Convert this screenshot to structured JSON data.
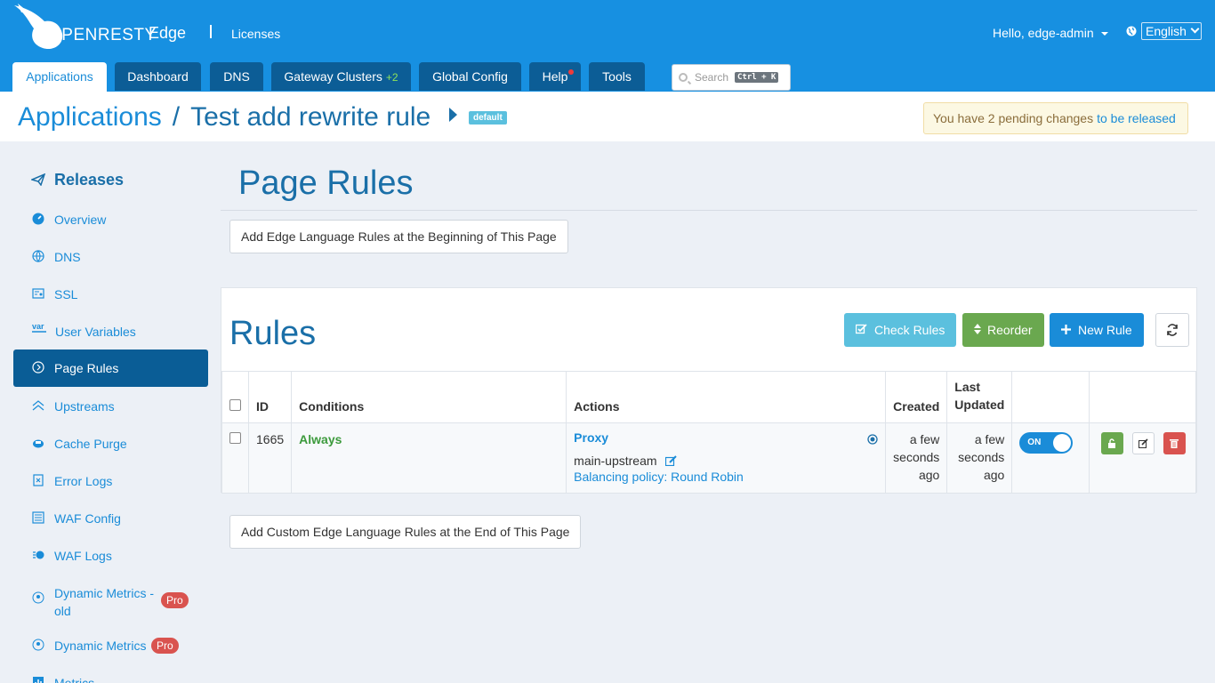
{
  "header": {
    "logo_text": "OPENRESTY",
    "product": "Edge",
    "licenses": "Licenses",
    "user": "Hello, edge-admin",
    "language": "English",
    "nav_tabs": [
      {
        "label": "Applications",
        "active": true
      },
      {
        "label": "Dashboard"
      },
      {
        "label": "DNS"
      },
      {
        "label": "Gateway Clusters",
        "extra": "+2"
      },
      {
        "label": "Global Config"
      },
      {
        "label": "Help",
        "notification_dot": true
      },
      {
        "label": "Tools"
      }
    ],
    "search": {
      "placeholder": "Search",
      "shortcut": "Ctrl + K"
    }
  },
  "breadcrumb": {
    "root": "Applications",
    "separator": "/",
    "current": "Test add rewrite rule",
    "badge": "default"
  },
  "pending": {
    "text": "You have 2 pending changes",
    "link": "to be released"
  },
  "sidebar": {
    "heading": "Releases",
    "items": [
      {
        "label": "Overview",
        "icon": "dashboard-icon"
      },
      {
        "label": "DNS",
        "icon": "globe-icon"
      },
      {
        "label": "SSL",
        "icon": "certificate-icon"
      },
      {
        "label": "User Variables",
        "icon": "var-icon"
      },
      {
        "label": "Page Rules",
        "icon": "rules-icon",
        "active": true
      },
      {
        "label": "Upstreams",
        "icon": "upstream-icon"
      },
      {
        "label": "Cache Purge",
        "icon": "cache-icon"
      },
      {
        "label": "Error Logs",
        "icon": "error-log-icon"
      },
      {
        "label": "WAF Config",
        "icon": "waf-config-icon"
      },
      {
        "label": "WAF Logs",
        "icon": "waf-logs-icon"
      },
      {
        "label": "Dynamic Metrics - old",
        "badge": "Pro",
        "icon": "metrics-icon"
      },
      {
        "label": "Dynamic Metrics",
        "badge": "Pro",
        "icon": "metrics-icon"
      },
      {
        "label": "Metrics",
        "icon": "bar-chart-icon"
      }
    ]
  },
  "main": {
    "title": "Page Rules",
    "add_begin": "Add Edge Language Rules at the Beginning of This Page",
    "add_end": "Add Custom Edge Language Rules at the End of This Page",
    "rules_title": "Rules",
    "buttons": {
      "check": "Check Rules",
      "reorder": "Reorder",
      "new": "New Rule"
    },
    "colors": {
      "check": "#5bc0de",
      "reorder": "#6aa84f",
      "new": "#1a8cd8",
      "danger": "#d9534f"
    },
    "table": {
      "headers": [
        "ID",
        "Conditions",
        "Actions",
        "Created",
        "Last Updated"
      ],
      "rows": [
        {
          "id": "1665",
          "condition": "Always",
          "action_title": "Proxy",
          "upstream": "main-upstream",
          "policy": "Balancing policy: Round Robin",
          "created": "a few seconds ago",
          "updated": "a few seconds ago",
          "toggle": "ON"
        }
      ]
    }
  }
}
